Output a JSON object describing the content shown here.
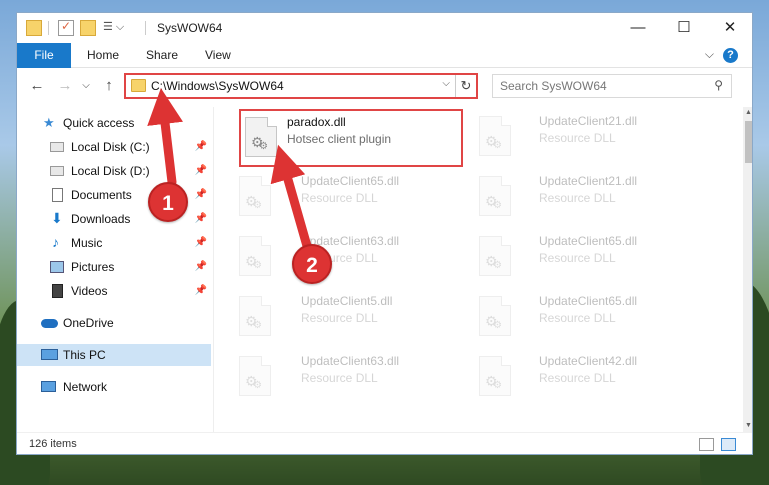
{
  "window": {
    "title": "SysWOW64",
    "controls": {
      "minimize": "—",
      "maximize": "☐",
      "close": "✕"
    }
  },
  "ribbon": {
    "tabs": [
      "File",
      "Home",
      "Share",
      "View"
    ],
    "help": "?",
    "expand": "⌵"
  },
  "address": {
    "path": "C:\\Windows\\SysWOW64",
    "dropdown": "⌵",
    "refresh": "↻"
  },
  "nav": {
    "back": "←",
    "forward": "→",
    "recent": "⌵",
    "up": "↑"
  },
  "search": {
    "placeholder": "Search SysWOW64",
    "icon": "⚲"
  },
  "sidebar": {
    "items": [
      {
        "label": "Quick access",
        "icon": "star-icon",
        "pinned": false
      },
      {
        "label": "Local Disk (C:)",
        "icon": "drive-icon",
        "pinned": true
      },
      {
        "label": "Local Disk (D:)",
        "icon": "drive-icon",
        "pinned": true
      },
      {
        "label": "Documents",
        "icon": "documents-icon",
        "pinned": true
      },
      {
        "label": "Downloads",
        "icon": "downloads-icon",
        "pinned": true
      },
      {
        "label": "Music",
        "icon": "music-icon",
        "pinned": true
      },
      {
        "label": "Pictures",
        "icon": "pictures-icon",
        "pinned": true
      },
      {
        "label": "Videos",
        "icon": "videos-icon",
        "pinned": true
      },
      {
        "label": "OneDrive",
        "icon": "onedrive-icon",
        "pinned": false
      },
      {
        "label": "This PC",
        "icon": "this-pc-icon",
        "pinned": false,
        "selected": true
      },
      {
        "label": "Network",
        "icon": "network-icon",
        "pinned": false
      }
    ],
    "pin_glyph": "📌"
  },
  "files": {
    "highlighted": {
      "name": "paradox.dll",
      "desc": "Hotsec client plugin"
    },
    "left": [
      {
        "name": "UpdateClient65.dll",
        "desc": "Resource DLL"
      },
      {
        "name": "UpdateClient63.dll",
        "desc": "Resource DLL"
      },
      {
        "name": "UpdateClient5.dll",
        "desc": "Resource DLL"
      },
      {
        "name": "UpdateClient63.dll",
        "desc": "Resource DLL"
      }
    ],
    "right": [
      {
        "name": "UpdateClient21.dll",
        "desc": "Resource DLL"
      },
      {
        "name": "UpdateClient21.dll",
        "desc": "Resource DLL"
      },
      {
        "name": "UpdateClient65.dll",
        "desc": "Resource DLL"
      },
      {
        "name": "UpdateClient65.dll",
        "desc": "Resource DLL"
      },
      {
        "name": "UpdateClient42.dll",
        "desc": "Resource DLL"
      }
    ]
  },
  "status": {
    "item_count": "126 items"
  },
  "annotations": {
    "marker1": "1",
    "marker2": "2",
    "color": "#d33333"
  },
  "colors": {
    "accent": "#1979ca",
    "highlight_border": "#e04545",
    "selected": "#cde3f6"
  }
}
